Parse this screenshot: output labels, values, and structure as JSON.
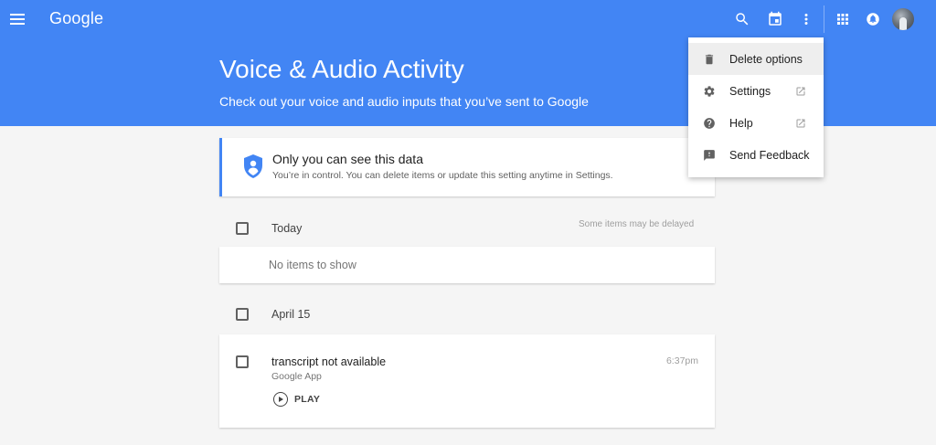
{
  "header": {
    "logo": "Google",
    "title": "Voice & Audio Activity",
    "subtitle": "Check out your voice and audio inputs that you’ve sent to Google",
    "icons": [
      "menu-icon",
      "search-icon",
      "calendar-icon",
      "more-vert-icon",
      "apps-grid-icon",
      "notifications-icon",
      "avatar"
    ]
  },
  "privacy": {
    "title": "Only you can see this data",
    "description": "You’re in control. You can delete items or update this setting anytime in Settings."
  },
  "today": {
    "label": "Today",
    "note": "Some items may be delayed",
    "empty": "No items to show"
  },
  "april": {
    "label": "April 15",
    "item": {
      "title": "transcript not available",
      "source": "Google App",
      "time": "6:37pm",
      "play_label": "PLAY"
    }
  },
  "menu": {
    "items": [
      {
        "label": "Delete options",
        "icon": "trash-icon",
        "external": false
      },
      {
        "label": "Settings",
        "icon": "gear-icon",
        "external": true
      },
      {
        "label": "Help",
        "icon": "help-icon",
        "external": true
      },
      {
        "label": "Send Feedback",
        "icon": "feedback-icon",
        "external": false
      }
    ]
  },
  "colors": {
    "brand_blue": "#4285f4",
    "background": "#f5f5f5",
    "menu_highlight": "#eeeeee"
  }
}
